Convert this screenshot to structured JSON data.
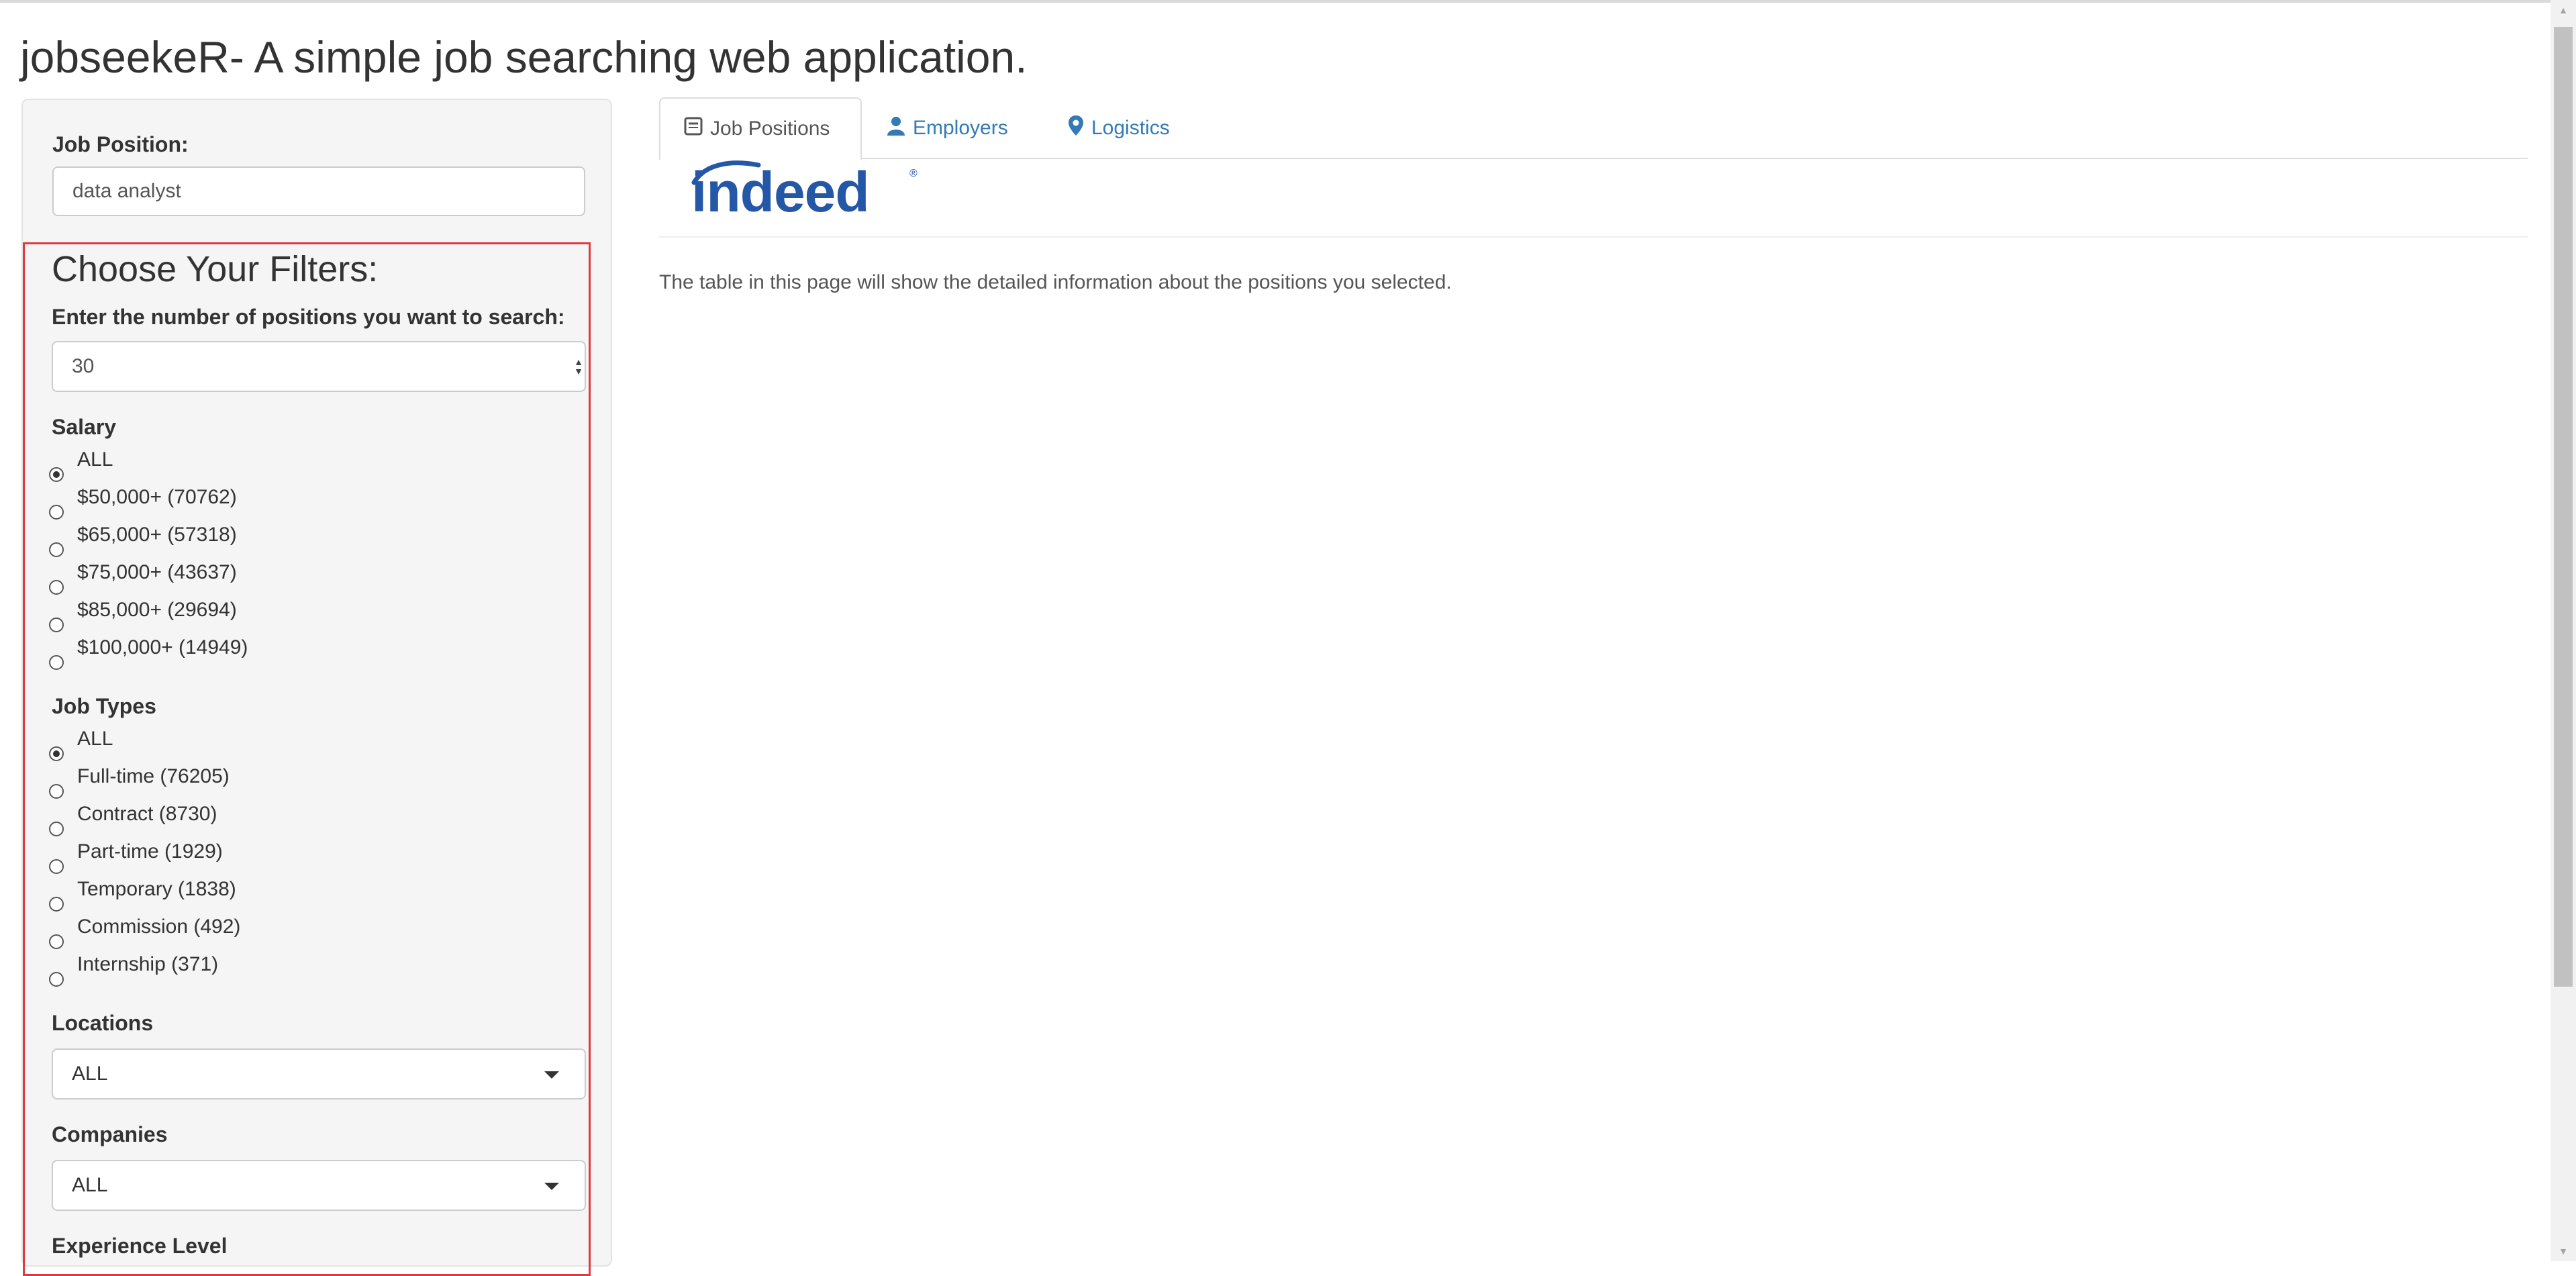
{
  "app": {
    "title": "jobseekeR- A simple job searching web application."
  },
  "sidebar": {
    "job_position": {
      "label": "Job Position:",
      "value": "data analyst"
    },
    "filters": {
      "heading": "Choose Your Filters:",
      "num_positions": {
        "label": "Enter the number of positions you want to search:",
        "value": "30"
      },
      "salary": {
        "label": "Salary",
        "options": [
          "ALL",
          "$50,000+ (70762)",
          "$65,000+ (57318)",
          "$75,000+ (43637)",
          "$85,000+ (29694)",
          "$100,000+ (14949)"
        ],
        "selected": "ALL"
      },
      "job_types": {
        "label": "Job Types",
        "options": [
          "ALL",
          "Full-time (76205)",
          "Contract (8730)",
          "Part-time (1929)",
          "Temporary (1838)",
          "Commission (492)",
          "Internship (371)"
        ],
        "selected": "ALL"
      },
      "locations": {
        "label": "Locations",
        "value": "ALL"
      },
      "companies": {
        "label": "Companies",
        "value": "ALL"
      },
      "experience_level": {
        "label": "Experience Level"
      }
    }
  },
  "main": {
    "tabs": [
      {
        "label": "Job Positions",
        "icon": "list-alt-icon",
        "active": true
      },
      {
        "label": "Employers",
        "icon": "user-icon",
        "active": false
      },
      {
        "label": "Logistics",
        "icon": "map-marker-icon",
        "active": false
      }
    ],
    "logo": {
      "text": "indeed",
      "registered": "®",
      "color": "#2557a7"
    },
    "description": "The table in this page will show the detailed information about the positions you selected."
  },
  "colors": {
    "link": "#337ab7",
    "filter_border": "#e0393e",
    "sidebar_bg": "#f5f5f5"
  }
}
